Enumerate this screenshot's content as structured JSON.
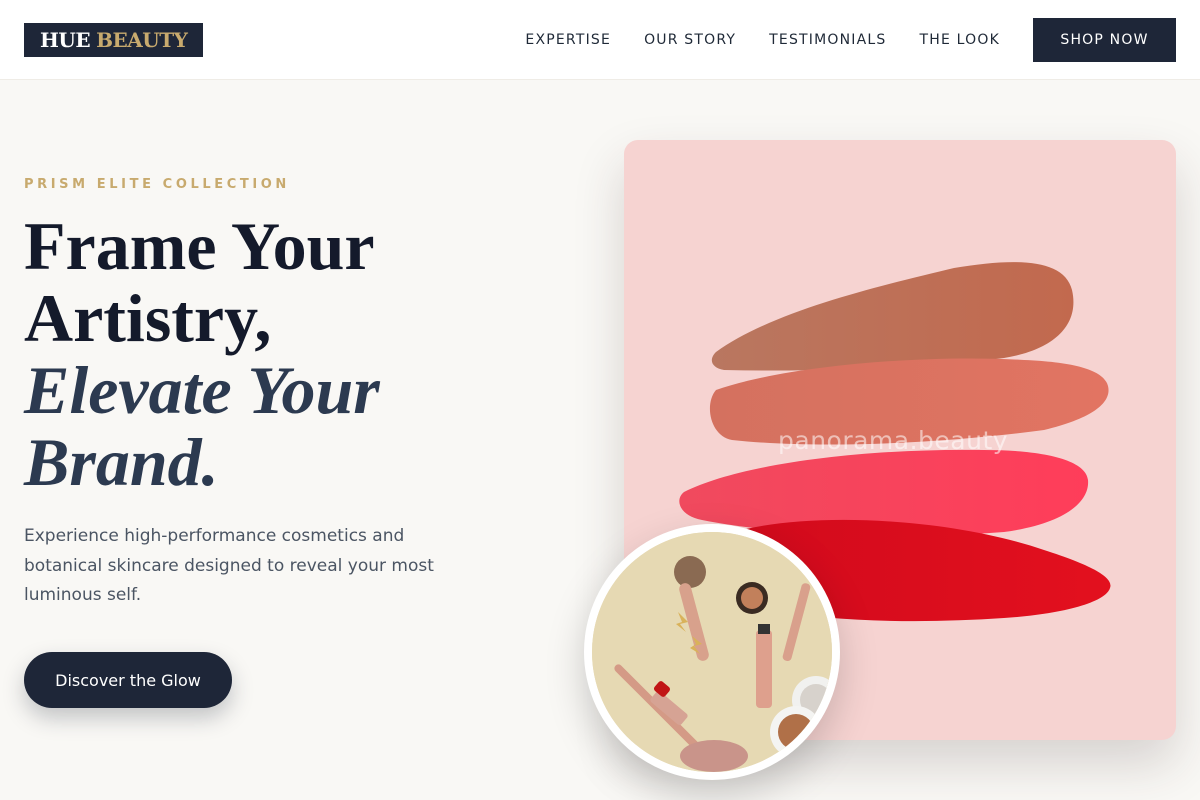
{
  "brand": {
    "word1": "HUE",
    "word2": "BEAUTY"
  },
  "nav": {
    "links": [
      "EXPERTISE",
      "OUR STORY",
      "TESTIMONIALS",
      "THE LOOK"
    ],
    "cta": "SHOP NOW"
  },
  "hero": {
    "eyebrow": "PRISM ELITE COLLECTION",
    "headline": [
      "Frame Your",
      "Artistry,"
    ],
    "headline_italic": [
      "Elevate Your",
      "Brand."
    ],
    "description": "Experience high-performance cosmetics and botanical skincare designed to reveal your most luminous self.",
    "cta": "Discover the Glow",
    "image_watermark": "panorama.beauty"
  },
  "colors": {
    "navy": "#1e2638",
    "gold": "#c8aa6e",
    "blush": "#f6d3d1",
    "page_bg": "#f9f8f5"
  },
  "icons": [
    "lipstick-swatches-image",
    "makeup-flatlay-image"
  ]
}
